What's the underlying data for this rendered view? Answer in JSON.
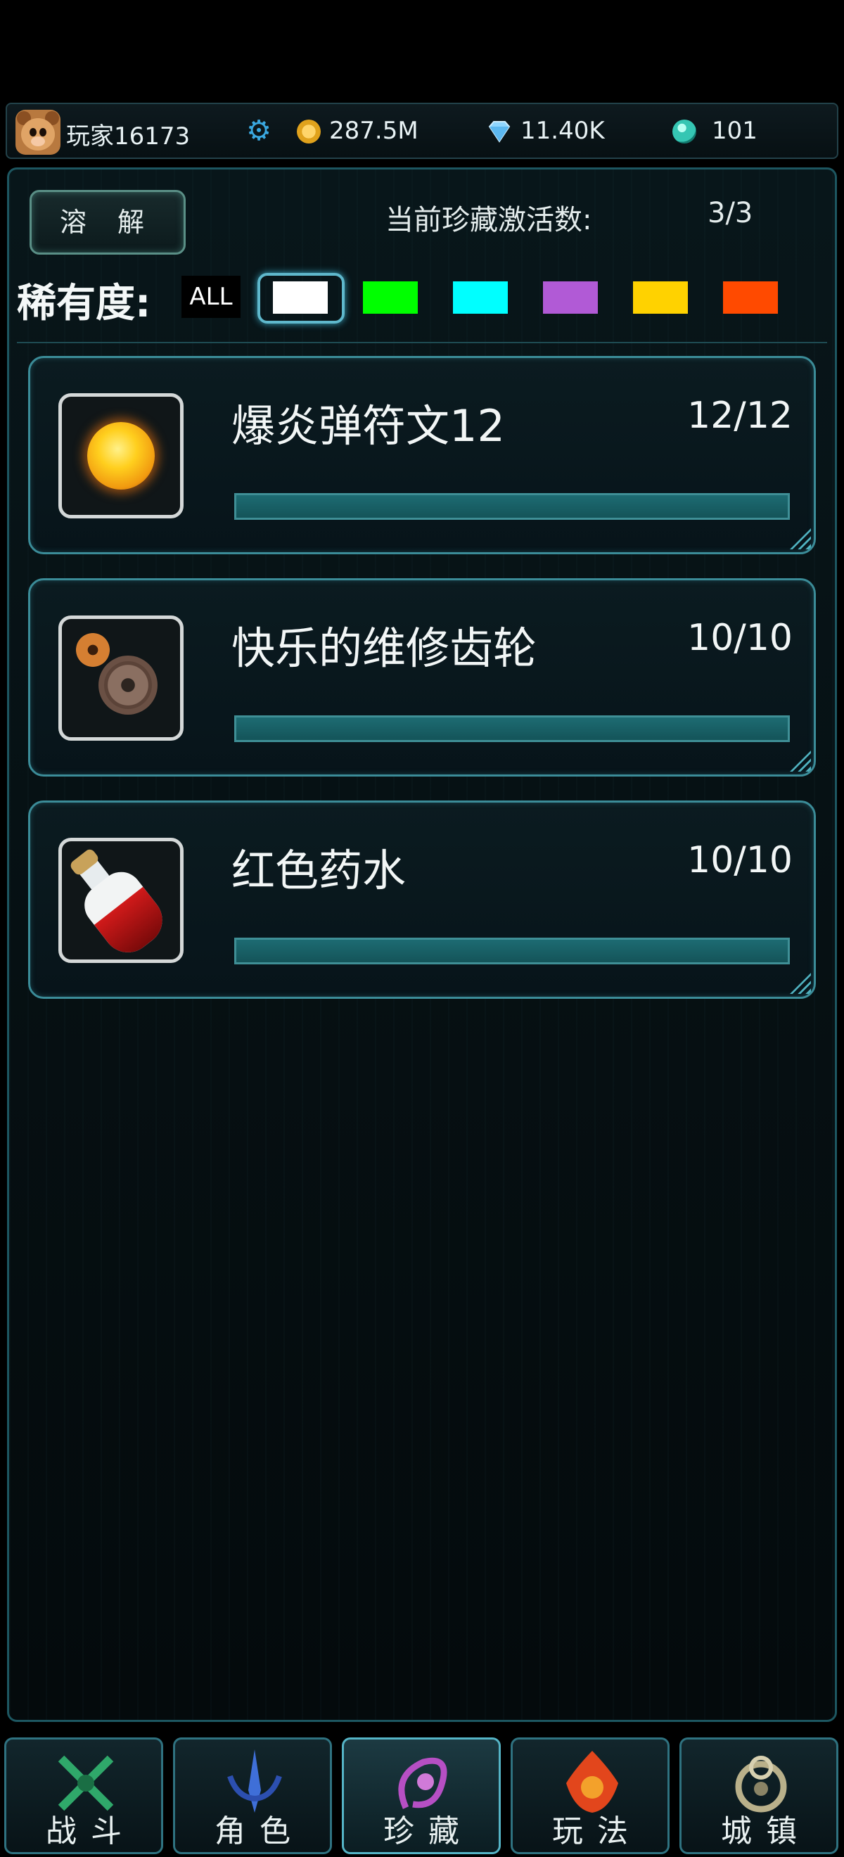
{
  "header": {
    "player_name": "玩家16173",
    "gold": "287.5M",
    "diamonds": "11.40K",
    "gems": "101"
  },
  "collection": {
    "dissolve_label": "溶 解",
    "active_label": "当前珍藏激活数:",
    "active_count": "3/3",
    "rarity_label": "稀有度:",
    "rarity_all": "ALL",
    "rarity_colors": [
      "#ffffff",
      "#00ff00",
      "#00ffff",
      "#b15ad6",
      "#ffd200",
      "#ff4a00"
    ],
    "selected_rarity": "#ffffff",
    "items": [
      {
        "name": "爆炎弹符文12",
        "count": "12/12",
        "progress": 1.0,
        "icon": "sun-orb-icon"
      },
      {
        "name": "快乐的维修齿轮",
        "count": "10/10",
        "progress": 1.0,
        "icon": "gears-icon"
      },
      {
        "name": "红色药水",
        "count": "10/10",
        "progress": 1.0,
        "icon": "red-potion-icon"
      }
    ]
  },
  "nav": {
    "items": [
      {
        "label": "战斗",
        "icon": "crossed-swords-icon",
        "active": false
      },
      {
        "label": "角色",
        "icon": "sword-emblem-icon",
        "active": false
      },
      {
        "label": "珍藏",
        "icon": "treasure-emblem-icon",
        "active": true
      },
      {
        "label": "玩法",
        "icon": "flame-emblem-icon",
        "active": false
      },
      {
        "label": "城镇",
        "icon": "town-emblem-icon",
        "active": false
      }
    ]
  }
}
